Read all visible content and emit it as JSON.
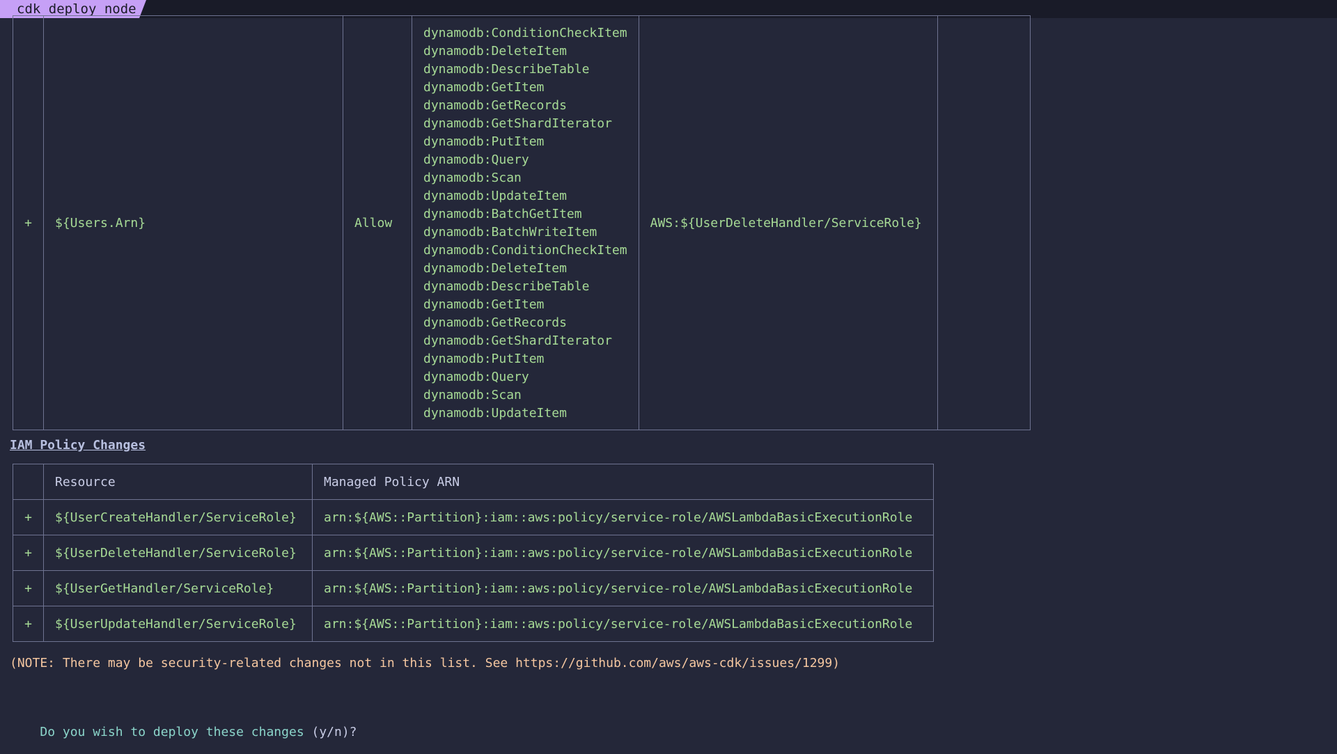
{
  "window": {
    "tab_title": "cdk deploy node"
  },
  "statement_row": {
    "change": "+",
    "resource": "${Users.Arn}",
    "effect": "Allow",
    "actions": [
      "dynamodb:ConditionCheckItem",
      "dynamodb:DeleteItem",
      "dynamodb:DescribeTable",
      "dynamodb:GetItem",
      "dynamodb:GetRecords",
      "dynamodb:GetShardIterator",
      "dynamodb:PutItem",
      "dynamodb:Query",
      "dynamodb:Scan",
      "dynamodb:UpdateItem",
      "dynamodb:BatchGetItem",
      "dynamodb:BatchWriteItem",
      "dynamodb:ConditionCheckItem",
      "dynamodb:DeleteItem",
      "dynamodb:DescribeTable",
      "dynamodb:GetItem",
      "dynamodb:GetRecords",
      "dynamodb:GetShardIterator",
      "dynamodb:PutItem",
      "dynamodb:Query",
      "dynamodb:Scan",
      "dynamodb:UpdateItem"
    ],
    "principal": "AWS:${UserDeleteHandler/ServiceRole}",
    "condition": ""
  },
  "policy_changes": {
    "heading": "IAM Policy Changes",
    "columns": [
      "",
      "Resource",
      "Managed Policy ARN"
    ],
    "rows": [
      {
        "change": "+",
        "resource": "${UserCreateHandler/ServiceRole}",
        "arn": "arn:${AWS::Partition}:iam::aws:policy/service-role/AWSLambdaBasicExecutionRole"
      },
      {
        "change": "+",
        "resource": "${UserDeleteHandler/ServiceRole}",
        "arn": "arn:${AWS::Partition}:iam::aws:policy/service-role/AWSLambdaBasicExecutionRole"
      },
      {
        "change": "+",
        "resource": "${UserGetHandler/ServiceRole}",
        "arn": "arn:${AWS::Partition}:iam::aws:policy/service-role/AWSLambdaBasicExecutionRole"
      },
      {
        "change": "+",
        "resource": "${UserUpdateHandler/ServiceRole}",
        "arn": "arn:${AWS::Partition}:iam::aws:policy/service-role/AWSLambdaBasicExecutionRole"
      }
    ]
  },
  "note": "(NOTE: There may be security-related changes not in this list. See https://github.com/aws/aws-cdk/issues/1299)",
  "prompt": {
    "question": "Do you wish to deploy these changes",
    "options": " (y/n)?"
  },
  "colors": {
    "background": "#242739",
    "tab": "#c6a0f6",
    "added_text": "#a6da95",
    "note_text": "#f5c7a0",
    "prompt_text": "#8bd5ca",
    "border": "#6e7391"
  }
}
